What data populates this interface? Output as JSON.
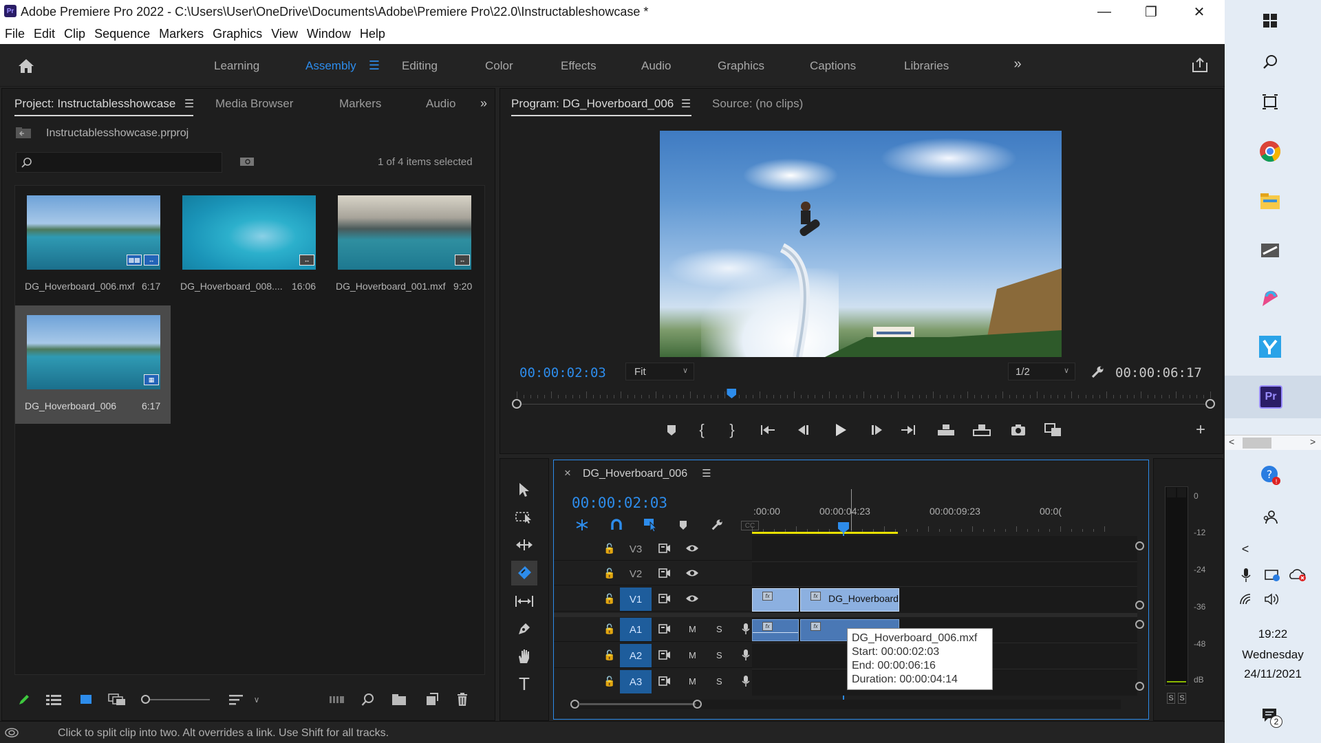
{
  "window": {
    "title": "Adobe Premiere Pro 2022 - C:\\Users\\User\\OneDrive\\Documents\\Adobe\\Premiere Pro\\22.0\\Instructableshowcase *",
    "app_icon": "Pr"
  },
  "menu": [
    "File",
    "Edit",
    "Clip",
    "Sequence",
    "Markers",
    "Graphics",
    "View",
    "Window",
    "Help"
  ],
  "workspaces": {
    "items": [
      "Learning",
      "Assembly",
      "Editing",
      "Color",
      "Effects",
      "Audio",
      "Graphics",
      "Captions",
      "Libraries"
    ],
    "active": "Assembly"
  },
  "project_panel": {
    "tabs": [
      "Project: Instructablesshowcase",
      "Media Browser",
      "Markers",
      "Audio"
    ],
    "project_file": "Instructablesshowcase.prproj",
    "search_placeholder": "",
    "selection_status": "1 of 4 items selected",
    "items": [
      {
        "name": "DG_Hoverboard_006.mxf",
        "duration": "6:17"
      },
      {
        "name": "DG_Hoverboard_008....",
        "duration": "16:06"
      },
      {
        "name": "DG_Hoverboard_001.mxf",
        "duration": "9:20"
      },
      {
        "name": "DG_Hoverboard_006",
        "duration": "6:17"
      }
    ]
  },
  "program_monitor": {
    "tab": "Program: DG_Hoverboard_006",
    "source_tab": "Source: (no clips)",
    "current_time": "00:00:02:03",
    "fit": "Fit",
    "resolution": "1/2",
    "duration": "00:00:06:17",
    "playhead_fraction": 0.31
  },
  "timeline": {
    "sequence_name": "DG_Hoverboard_006",
    "current_time": "00:00:02:03",
    "ruler": [
      ":00:00",
      "00:00:04:23",
      "00:00:09:23",
      "00:0("
    ],
    "video_tracks": [
      "V3",
      "V2",
      "V1"
    ],
    "audio_tracks": [
      "A1",
      "A2",
      "A3"
    ],
    "track_m": "M",
    "track_s": "S",
    "clip_label": "DG_Hoverboard",
    "tooltip": {
      "name": "DG_Hoverboard_006.mxf",
      "start": "Start: 00:00:02:03",
      "end": "End: 00:00:06:16",
      "duration": "Duration: 00:00:04:14"
    }
  },
  "audio_meter": {
    "scale": [
      "0",
      "-12",
      "-24",
      "-36",
      "-48",
      "dB"
    ],
    "solo": [
      "S",
      "S"
    ]
  },
  "status_bar": "Click to split clip into two. Alt overrides a link. Use Shift for all tracks.",
  "taskbar": {
    "time": "19:22",
    "day": "Wednesday",
    "date": "24/11/2021",
    "notification_count": "2",
    "premiere_label": "Pr"
  },
  "colors": {
    "accent": "#2d8ceb",
    "clip_video": "#8cb0e0",
    "track_on": "#1e5d9c",
    "work_area": "#e8e000"
  }
}
